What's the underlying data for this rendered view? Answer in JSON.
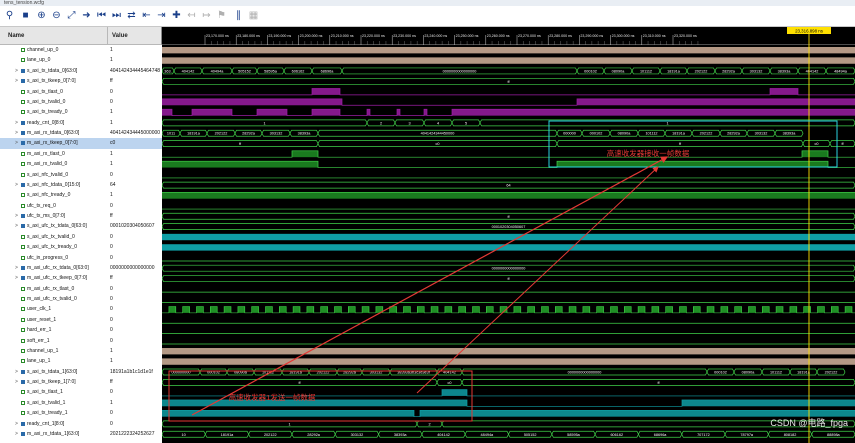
{
  "window": {
    "title": "tens_tension.wcfg"
  },
  "toolbar": {
    "icons": [
      "search-icon",
      "save-icon",
      "zoom-in-icon",
      "zoom-out-icon",
      "zoom-fit-icon",
      "cursor-to-zero-icon",
      "go-to-start-icon",
      "go-to-end-icon",
      "swap-cursor-icon",
      "previous-transition-icon",
      "next-transition-icon",
      "add-marker-icon",
      "previous-marker-icon",
      "next-marker-icon",
      "marker-icon",
      "snap-icon",
      "toggle-icon"
    ]
  },
  "columns": {
    "name": "Name",
    "value": "Value"
  },
  "cursor": {
    "label": "23,316.898 ns"
  },
  "time_ticks": [
    "23,170.000 ns",
    "23,180.000 ns",
    "23,190.000 ns",
    "23,200.000 ns",
    "23,210.000 ns",
    "23,220.000 ns",
    "23,230.000 ns",
    "23,240.000 ns",
    "23,250.000 ns",
    "23,260.000 ns",
    "23,270.000 ns",
    "23,280.000 ns",
    "23,290.000 ns",
    "23,300.000 ns",
    "23,310.000 ns",
    "23,320.000 ns"
  ],
  "signals": [
    {
      "name": "channel_up_0",
      "value": "1",
      "kind": "bit",
      "expand": false
    },
    {
      "name": "lane_up_0",
      "value": "1",
      "kind": "bit",
      "expand": false
    },
    {
      "name": "s_axi_tx_tdata_0[63:0]",
      "value": "404142434445464748",
      "kind": "bus",
      "expand": true
    },
    {
      "name": "s_axi_tx_tkeep_0[7:0]",
      "value": "ff",
      "kind": "bus",
      "expand": true
    },
    {
      "name": "s_axi_tx_tlast_0",
      "value": "0",
      "kind": "bit",
      "expand": false
    },
    {
      "name": "s_axi_tx_tvalid_0",
      "value": "0",
      "kind": "bit",
      "expand": false
    },
    {
      "name": "s_axi_tx_tready_0",
      "value": "1",
      "kind": "bit",
      "expand": false
    },
    {
      "name": "ready_cnt_0[8:0]",
      "value": "1",
      "kind": "bus",
      "expand": true
    },
    {
      "name": "m_axi_rx_tdata_0[63:0]",
      "value": "404142434445000000",
      "kind": "bus",
      "expand": true
    },
    {
      "name": "m_axi_rx_tkeep_0[7:0]",
      "value": "c0",
      "kind": "bus",
      "expand": true,
      "selected": true
    },
    {
      "name": "m_axi_rx_tlast_0",
      "value": "1",
      "kind": "bit",
      "expand": false
    },
    {
      "name": "m_axi_rx_tvalid_0",
      "value": "1",
      "kind": "bit",
      "expand": false
    },
    {
      "name": "s_axi_nfc_tvalid_0",
      "value": "0",
      "kind": "bit",
      "expand": false
    },
    {
      "name": "s_axi_nfc_tdata_0[15:0]",
      "value": "64",
      "kind": "bus",
      "expand": true
    },
    {
      "name": "s_axi_nfc_tready_0",
      "value": "1",
      "kind": "bit",
      "expand": false
    },
    {
      "name": "ufc_tx_req_0",
      "value": "0",
      "kind": "bit",
      "expand": false
    },
    {
      "name": "ufc_tx_ms_0[7:0]",
      "value": "ff",
      "kind": "bus",
      "expand": true
    },
    {
      "name": "s_axi_ufc_tx_tdata_0[63:0]",
      "value": "0001020304050607",
      "kind": "bus",
      "expand": true
    },
    {
      "name": "s_axi_ufc_tx_tvalid_0",
      "value": "0",
      "kind": "bit",
      "expand": false
    },
    {
      "name": "s_axi_ufc_tx_tready_0",
      "value": "0",
      "kind": "bit",
      "expand": false
    },
    {
      "name": "ufc_in_progress_0",
      "value": "0",
      "kind": "bit",
      "expand": false
    },
    {
      "name": "m_axi_ufc_rx_tdata_0[63:0]",
      "value": "0000000000000000",
      "kind": "bus",
      "expand": true
    },
    {
      "name": "m_axi_ufc_rx_tkeep_0[7:0]",
      "value": "ff",
      "kind": "bus",
      "expand": true
    },
    {
      "name": "m_axi_ufc_rx_tlast_0",
      "value": "0",
      "kind": "bit",
      "expand": false
    },
    {
      "name": "m_axi_ufc_rx_tvalid_0",
      "value": "0",
      "kind": "bit",
      "expand": false
    },
    {
      "name": "user_clk_1",
      "value": "0",
      "kind": "bit",
      "expand": false
    },
    {
      "name": "user_reset_1",
      "value": "0",
      "kind": "bit",
      "expand": false
    },
    {
      "name": "hard_err_1",
      "value": "0",
      "kind": "bit",
      "expand": false
    },
    {
      "name": "soft_err_1",
      "value": "0",
      "kind": "bit",
      "expand": false
    },
    {
      "name": "channel_up_1",
      "value": "1",
      "kind": "bit",
      "expand": false
    },
    {
      "name": "lane_up_1",
      "value": "1",
      "kind": "bit",
      "expand": false
    },
    {
      "name": "s_axi_tx_tdata_1[63:0]",
      "value": "18191a1b1c1d1e1f",
      "kind": "bus",
      "expand": true
    },
    {
      "name": "s_axi_tx_tkeep_1[7:0]",
      "value": "ff",
      "kind": "bus",
      "expand": true
    },
    {
      "name": "s_axi_tx_tlast_1",
      "value": "0",
      "kind": "bit",
      "expand": false
    },
    {
      "name": "s_axi_tx_tvalid_1",
      "value": "1",
      "kind": "bit",
      "expand": false
    },
    {
      "name": "s_axi_tx_tready_1",
      "value": "0",
      "kind": "bit",
      "expand": false
    },
    {
      "name": "ready_cnt_1[8:0]",
      "value": "0",
      "kind": "bus",
      "expand": true
    },
    {
      "name": "m_axi_rx_tdata_1[63:0]",
      "value": "2021222324252627",
      "kind": "bus",
      "expand": true
    }
  ],
  "wave_labels": {
    "tx0_data": [
      "363.",
      "404142",
      "40494a",
      "505152",
      "58595a",
      "606162",
      "68696a",
      "0000000000000000",
      "000102",
      "08090a",
      "101112",
      "18191a",
      "202122",
      "28292a",
      "303132",
      "38393a",
      "404142",
      "48494a"
    ],
    "tx0_keep": "ff",
    "ready0": [
      "1",
      "2",
      "3",
      "4",
      "5",
      "1"
    ],
    "rx0_data": [
      "1011",
      "18191a",
      "202122",
      "28292a",
      "303132",
      "38393a",
      "4041424344450000",
      "000000",
      "000102",
      "08090a",
      "101112",
      "18191a",
      "202122",
      "28292a",
      "303132",
      "38393a"
    ],
    "rx0_keep_a": "ff",
    "rx0_keep_b": "c0",
    "rx0_keep_c": "ff",
    "nfc_data": "64",
    "ufc_ms": "ff",
    "ufc_tx_data": "0001020304050607",
    "ufc_rx_data": "0000000000000000",
    "ufc_rx_keep": "ff",
    "tx1_data": [
      "000000000",
      "000102",
      "08090a",
      "101112",
      "18191a",
      "202122",
      "28292a",
      "303132",
      "38393a3b3c3d3e3f",
      "404142",
      "0000000000000000",
      "000102",
      "08090a",
      "101112",
      "18191a",
      "202122"
    ],
    "tx1_keep_a": "ff",
    "tx1_keep_b": "c0",
    "tx1_keep_c": "ff",
    "ready1": [
      "1",
      "2"
    ],
    "rx1_data": [
      "10",
      "18191a",
      "202122",
      "28292a",
      "303132",
      "38393a",
      "404142",
      "48494a",
      "505152",
      "58595a",
      "606162",
      "68696a",
      "707172",
      "78797a",
      "808182",
      "88898a"
    ]
  },
  "annotations": {
    "rx_note": "高速收发器接收一帧数据",
    "tx_note": "高速收发器1发送一帧数据"
  },
  "watermark": "CSDN @电路_fpga",
  "colors": {
    "bus": "#41d24a",
    "bit": "#41d24a",
    "teal": "#0f9fa6",
    "magenta": "#9b1da3",
    "tan": "#b59a86",
    "cursor": "#ffe000",
    "annotation": "#e53935",
    "box_cyan": "#2ad5e2"
  }
}
